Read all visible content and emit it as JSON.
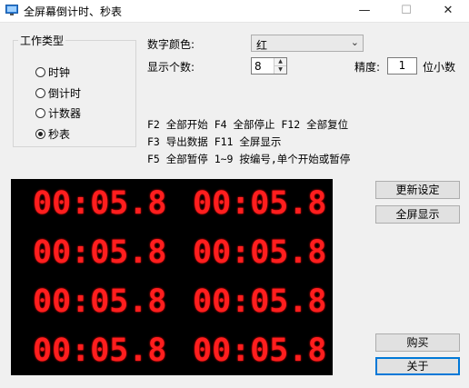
{
  "window": {
    "title": "全屏幕倒计时、秒表",
    "minimize": "—",
    "maximize": "☐",
    "close": "✕"
  },
  "work_type": {
    "title": "工作类型",
    "options": [
      {
        "label": "时钟",
        "checked": false
      },
      {
        "label": "倒计时",
        "checked": false
      },
      {
        "label": "计数器",
        "checked": false
      },
      {
        "label": "秒表",
        "checked": true
      }
    ]
  },
  "settings": {
    "digit_color_label": "数字颜色:",
    "digit_color_value": "红",
    "display_count_label": "显示个数:",
    "display_count_value": "8",
    "precision_label": "精度:",
    "precision_value": "1",
    "decimal_suffix": "位小数"
  },
  "shortcuts": [
    "F2 全部开始 F4 全部停止 F12 全部复位",
    "F3 导出数据 F11 全屏显示",
    "F5 全部暂停 1~9 按编号,单个开始或暂停"
  ],
  "display": {
    "digit_color": "#ff1e1e",
    "clocks": [
      "00:05.8",
      "00:05.8",
      "00:05.8",
      "00:05.8",
      "00:05.8",
      "00:05.8",
      "00:05.8",
      "00:05.8"
    ]
  },
  "buttons": {
    "update_settings": "更新设定",
    "fullscreen": "全屏显示",
    "buy": "购买",
    "about": "关于"
  }
}
